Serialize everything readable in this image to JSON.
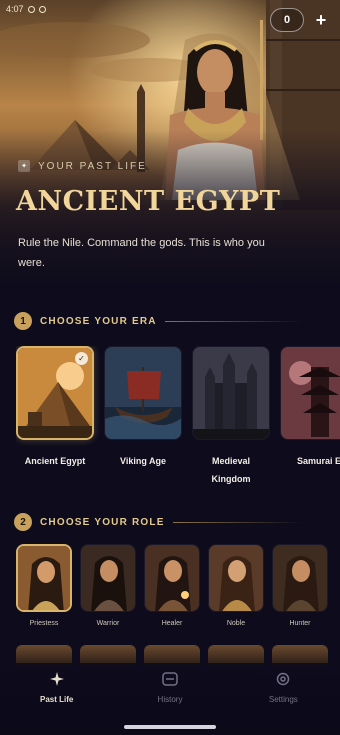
{
  "status": {
    "time": "4:07"
  },
  "header": {
    "coin_count": "0",
    "add_label": "+"
  },
  "hero": {
    "eyebrow": "YOUR PAST LIFE",
    "title": "ANCIENT EGYPT",
    "subtitle": "Rule the Nile. Command the gods. This is who you were."
  },
  "era_section": {
    "number": "1",
    "label": "CHOOSE YOUR ERA",
    "items": [
      {
        "label": "Ancient Egypt",
        "selected": true
      },
      {
        "label": "Viking Age",
        "selected": false
      },
      {
        "label": "Medieval Kingdom",
        "selected": false
      },
      {
        "label": "Samurai E",
        "selected": false
      }
    ]
  },
  "role_section": {
    "number": "2",
    "label": "CHOOSE YOUR ROLE",
    "items": [
      {
        "label": "Priestess",
        "selected": true
      },
      {
        "label": "Warrior",
        "selected": false
      },
      {
        "label": "Healer",
        "selected": false
      },
      {
        "label": "Noble",
        "selected": false
      },
      {
        "label": "Hunter",
        "selected": false
      }
    ]
  },
  "nav": {
    "items": [
      {
        "label": "Past Life",
        "icon": "sparkle-icon",
        "active": true
      },
      {
        "label": "History",
        "icon": "history-icon",
        "active": false
      },
      {
        "label": "Settings",
        "icon": "gear-icon",
        "active": false
      }
    ]
  },
  "colors": {
    "accent": "#d8b56a",
    "background": "#0d0b1c",
    "title_gold": "#f1d59a"
  }
}
